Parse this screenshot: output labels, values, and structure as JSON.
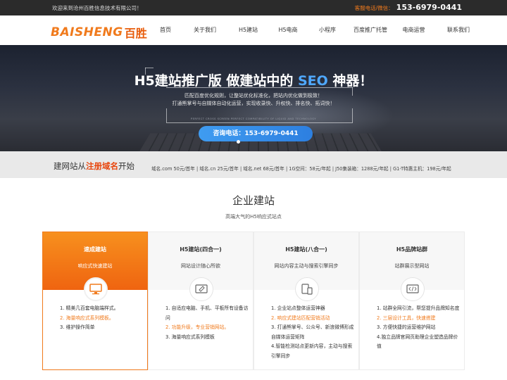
{
  "topbar": {
    "welcome": "欢迎来到沧州百胜信息技术有限公司！",
    "contact_label": "客服电话/微信：",
    "contact_phone": "153-6979-0441"
  },
  "logo": {
    "en": "BAISHENG",
    "cn": "百胜"
  },
  "nav": {
    "items": [
      "首页",
      "关于我们",
      "H5建站",
      "H5电商",
      "小程序",
      "百度推广托管",
      "电商运营",
      "联系我们"
    ]
  },
  "banner": {
    "title_part1": "H5建站推广版 做建站中的 ",
    "title_seo": "SEO",
    "title_part2": " 神器！",
    "line1": "匹配百度优化规则，让整站优化标准化，把站内优化做到极致！",
    "line2": "打通熊掌号与自媒体自动化运营，实现收录快、升权快、排名快、拓词快！",
    "tiny": "PERFECT CROSS SCREEN PERFECT COMPATIBILITY OF LIQUID AND TECHNOLOGY",
    "button": "咨询电话：153-6979-0441"
  },
  "domain": {
    "title_pre": "建网站从",
    "title_hl": "注册域名",
    "title_post": "开始",
    "prices": "域名.com 50元/首年 | 域名.cn 25元/首年 | 域名.net 68元/首年 | 1G空间：58元/年起 | J50集装箱：1288元/年起 | G1-T特惠主机：198元/年起"
  },
  "section": {
    "title": "企业建站",
    "subtitle": "高端大气的H5响应式站点"
  },
  "cards": [
    {
      "title": "速成建站",
      "subtitle": "响应式快速建站",
      "icon": "monitor-icon",
      "items": [
        {
          "text": "1. 精美几百套电脑端样式。",
          "orange": false
        },
        {
          "text": "2. 海量响应式系列模板。",
          "orange": true
        },
        {
          "text": "3. 维护操作简单",
          "orange": false
        }
      ]
    },
    {
      "title": "H5建站(四合一)",
      "subtitle": "网站设计随心所欲",
      "icon": "design-icon",
      "items": [
        {
          "text": "1. 自适应电脑、手机、平板所有设备访问",
          "orange": false
        },
        {
          "text": "2. 功能升级，专业营销网站。",
          "orange": true
        },
        {
          "text": "3. 海量响应式系列模板",
          "orange": false
        }
      ]
    },
    {
      "title": "H5建站(八合一)",
      "subtitle": "网站内容主动与搜索引擎同步",
      "icon": "devices-icon",
      "items": [
        {
          "text": "1. 企业站点整体运营神器",
          "orange": false
        },
        {
          "text": "2. 响应式建站匹配营销活动",
          "orange": true
        },
        {
          "text": "3. 打通熊掌号、公众号、新浪微博形成自媒体运营矩阵",
          "orange": false
        },
        {
          "text": "4.智能检测站点更新内容，主动与搜索引擎同步",
          "orange": false
        }
      ]
    },
    {
      "title": "H5品牌站群",
      "subtitle": "站群展示型网站",
      "icon": "code-icon",
      "items": [
        {
          "text": "1. 站群全网引流，帮您提升品牌知名度",
          "orange": false
        },
        {
          "text": "2. 三层设计工具，快速搭建",
          "orange": true
        },
        {
          "text": "3. 方便快捷的运营维护网站",
          "orange": false
        },
        {
          "text": "4.独立品牌官网页助理企业塑造品牌价值",
          "orange": false
        }
      ]
    }
  ],
  "colors": {
    "accent": "#f07a1c",
    "highlight": "#e8450c",
    "blue": "#4fa8ff"
  }
}
